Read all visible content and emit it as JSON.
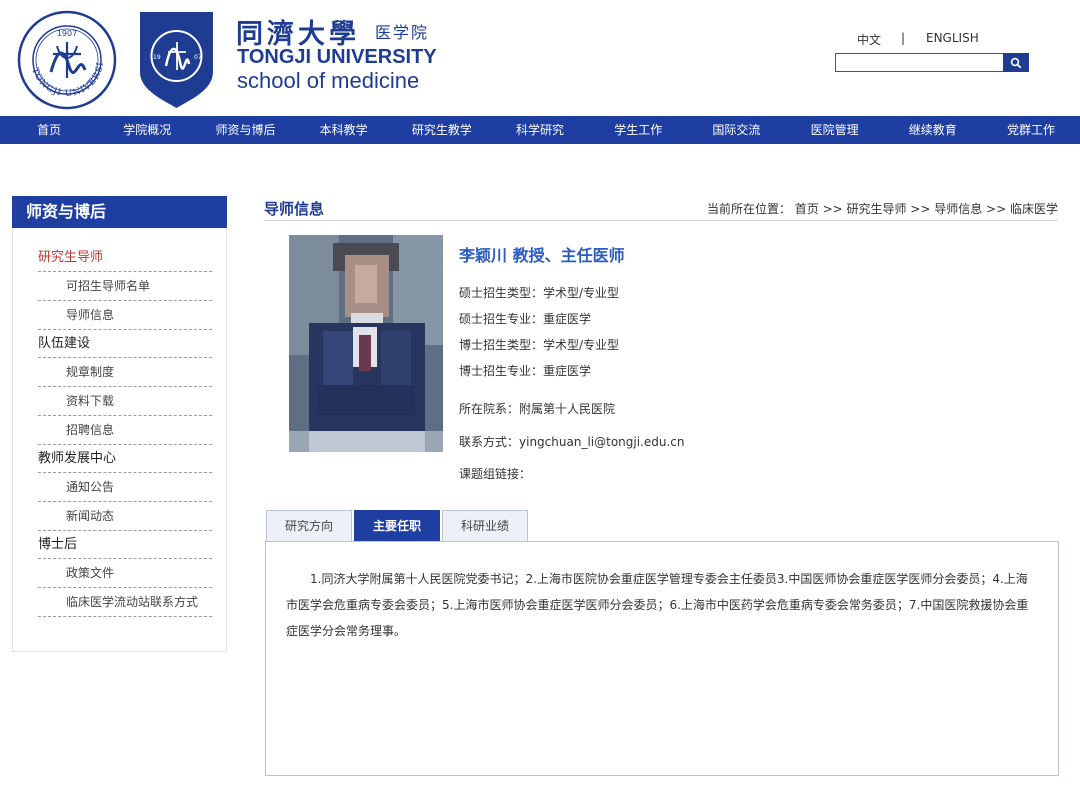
{
  "header": {
    "logo_cn": "同濟大學",
    "logo_cn_sub": "医学院",
    "logo_en_line1": "TONGJI UNIVERSITY",
    "logo_en_line2": "school of medicine",
    "seal_text": "TONGJI UNIVERSITY",
    "seal_year": "1907",
    "lang_cn": "中文",
    "lang_sep": "|",
    "lang_en": "ENGLISH",
    "search_placeholder": "",
    "search_icon": "search-icon"
  },
  "nav": {
    "items": [
      "首页",
      "学院概况",
      "师资与博后",
      "本科教学",
      "研究生教学",
      "科学研究",
      "学生工作",
      "国际交流",
      "医院管理",
      "继续教育",
      "党群工作"
    ]
  },
  "sidebar": {
    "title": "师资与博后",
    "groups": [
      {
        "label": "研究生导师",
        "active": true,
        "children": [
          "可招生导师名单",
          "导师信息"
        ]
      },
      {
        "label": "队伍建设",
        "active": false,
        "children": [
          "规章制度",
          "资料下载",
          "招聘信息"
        ]
      },
      {
        "label": "教师发展中心",
        "active": false,
        "children": [
          "通知公告",
          "新闻动态"
        ]
      },
      {
        "label": "博士后",
        "active": false,
        "children": [
          "政策文件",
          "临床医学流动站联系方式"
        ]
      }
    ]
  },
  "main": {
    "title": "导师信息",
    "breadcrumb": "当前所在位置： 首页 >> 研究生导师 >> 导师信息 >> 临床医学",
    "name_title": "李颖川   教授、主任医师",
    "fields": [
      {
        "label": "硕士招生类型：",
        "value": "学术型/专业型"
      },
      {
        "label": "硕士招生专业：",
        "value": "重症医学"
      },
      {
        "label": "博士招生类型：",
        "value": "学术型/专业型"
      },
      {
        "label": "博士招生专业：",
        "value": "重症医学"
      },
      {
        "label": "所在院系：",
        "value": "附属第十人民医院"
      },
      {
        "label": "联系方式：",
        "value": "yingchuan_li@tongji.edu.cn"
      },
      {
        "label": "课题组链接：",
        "value": ""
      }
    ],
    "tabs": [
      "研究方向",
      "主要任职",
      "科研业绩"
    ],
    "active_tab": "主要任职",
    "panel_text": "1.同济大学附属第十人民医院党委书记；2.上海市医院协会重症医学管理专委会主任委员3.中国医师协会重症医学医师分会委员；4.上海市医学会危重病专委会委员；5.上海市医师协会重症医学医师分会委员；6.上海市中医药学会危重病专委会常务委员；7.中国医院救援协会重症医学分会常务理事。"
  },
  "colors": {
    "brand_blue": "#1f3ea1",
    "title_blue": "#1f3c93",
    "name_blue": "#2a5cc2",
    "active_red": "#b93a32"
  }
}
